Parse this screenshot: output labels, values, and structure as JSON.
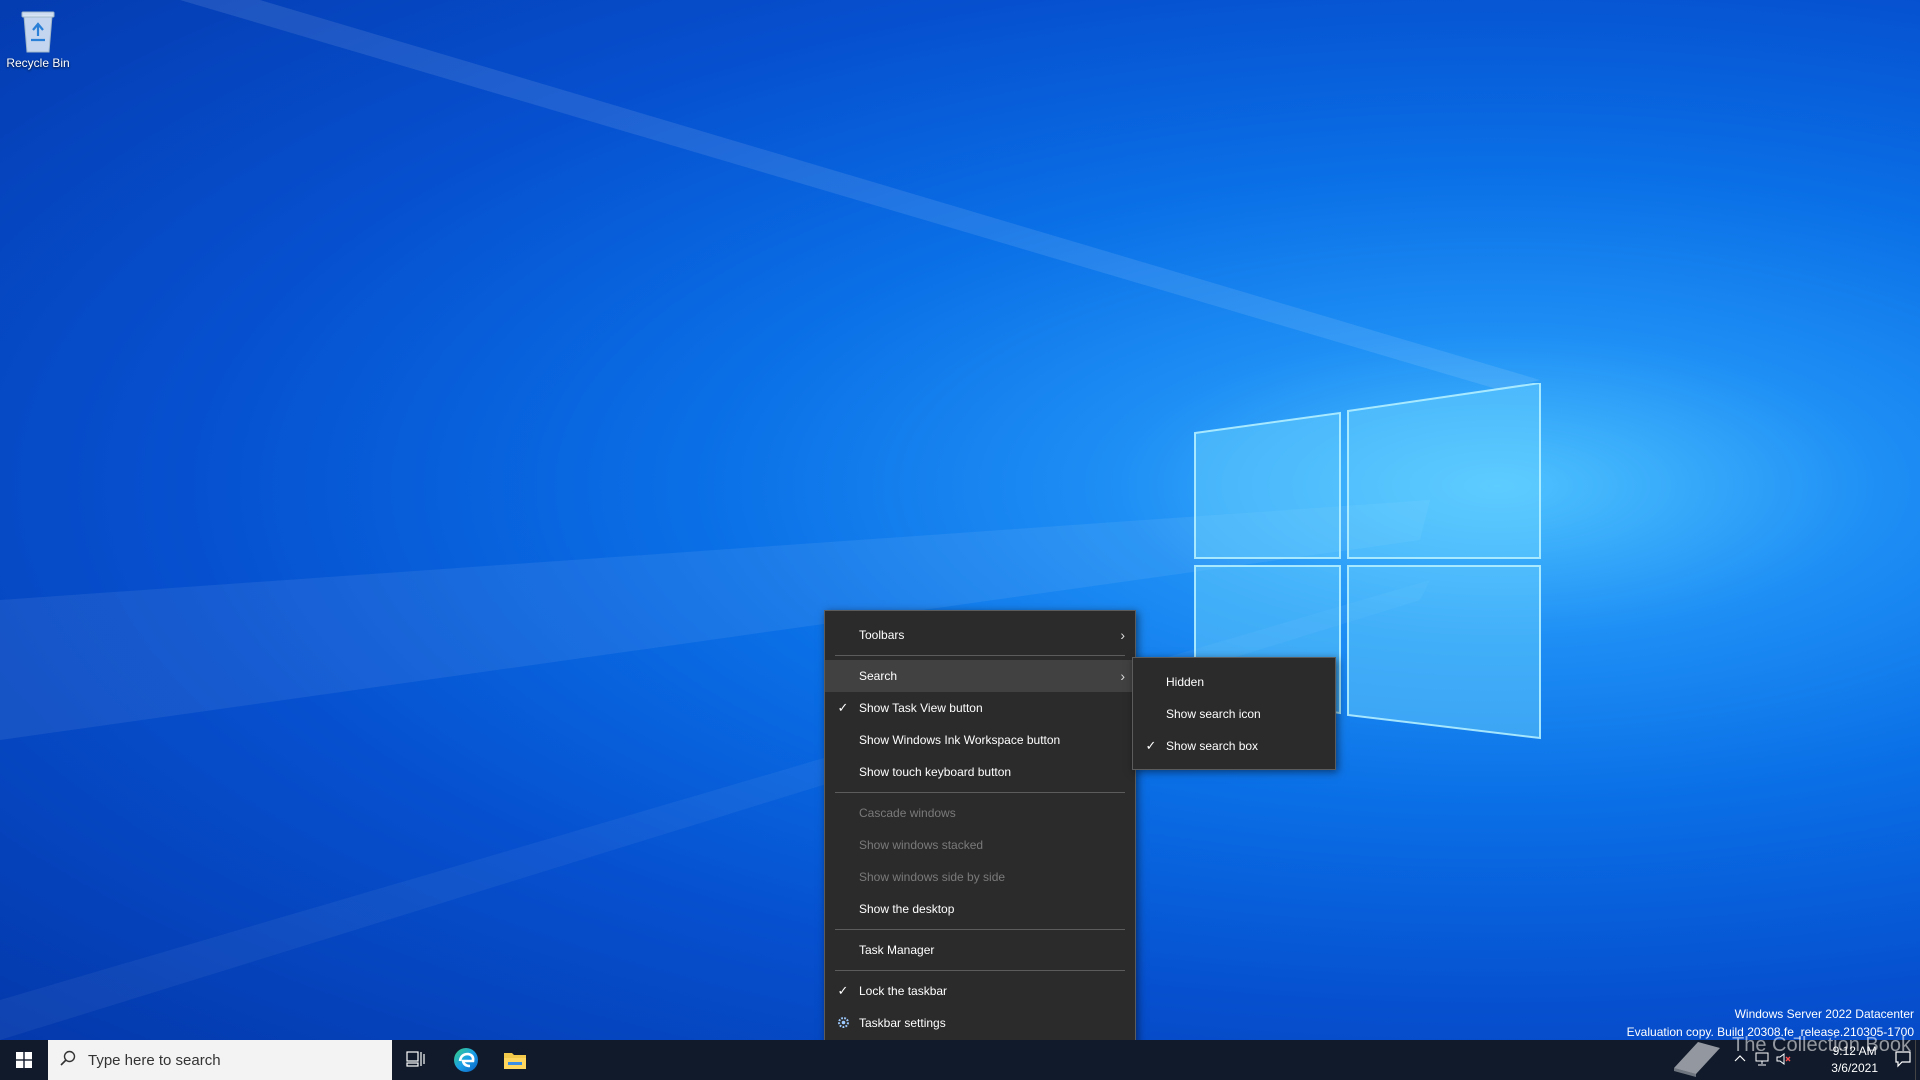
{
  "desktop": {
    "icons": [
      {
        "label": "Recycle Bin",
        "icon": "recycle-bin-icon"
      }
    ]
  },
  "context_menu": {
    "items": [
      {
        "label": "Toolbars",
        "submenu": true
      },
      {
        "label": "Search",
        "submenu": true,
        "highlighted": true
      },
      {
        "label": "Show Task View button",
        "checked": true
      },
      {
        "label": "Show Windows Ink Workspace button"
      },
      {
        "label": "Show touch keyboard button"
      },
      {
        "label": "Cascade windows",
        "disabled": true
      },
      {
        "label": "Show windows stacked",
        "disabled": true
      },
      {
        "label": "Show windows side by side",
        "disabled": true
      },
      {
        "label": "Show the desktop"
      },
      {
        "label": "Task Manager"
      },
      {
        "label": "Lock the taskbar",
        "checked": true
      },
      {
        "label": "Taskbar settings",
        "icon": "gear-icon"
      }
    ]
  },
  "search_submenu": {
    "items": [
      {
        "label": "Hidden"
      },
      {
        "label": "Show search icon"
      },
      {
        "label": "Show search box",
        "checked": true
      }
    ]
  },
  "watermark": {
    "line1": "Windows Server 2022 Datacenter",
    "line2": "Evaluation copy. Build 20308.fe_release.210305-1700"
  },
  "brand": "The Collection Book",
  "taskbar": {
    "search_placeholder": "Type here to search",
    "pinned": [
      "task-view-icon",
      "edge-icon",
      "file-explorer-icon"
    ],
    "clock": {
      "time": "9:12 AM",
      "date": "3/6/2021"
    }
  },
  "colors": {
    "menu_bg": "#2b2b2b",
    "menu_highlight": "#414141",
    "menu_disabled_text": "#7a7a7a",
    "taskbar_bg": "#101a2a"
  }
}
